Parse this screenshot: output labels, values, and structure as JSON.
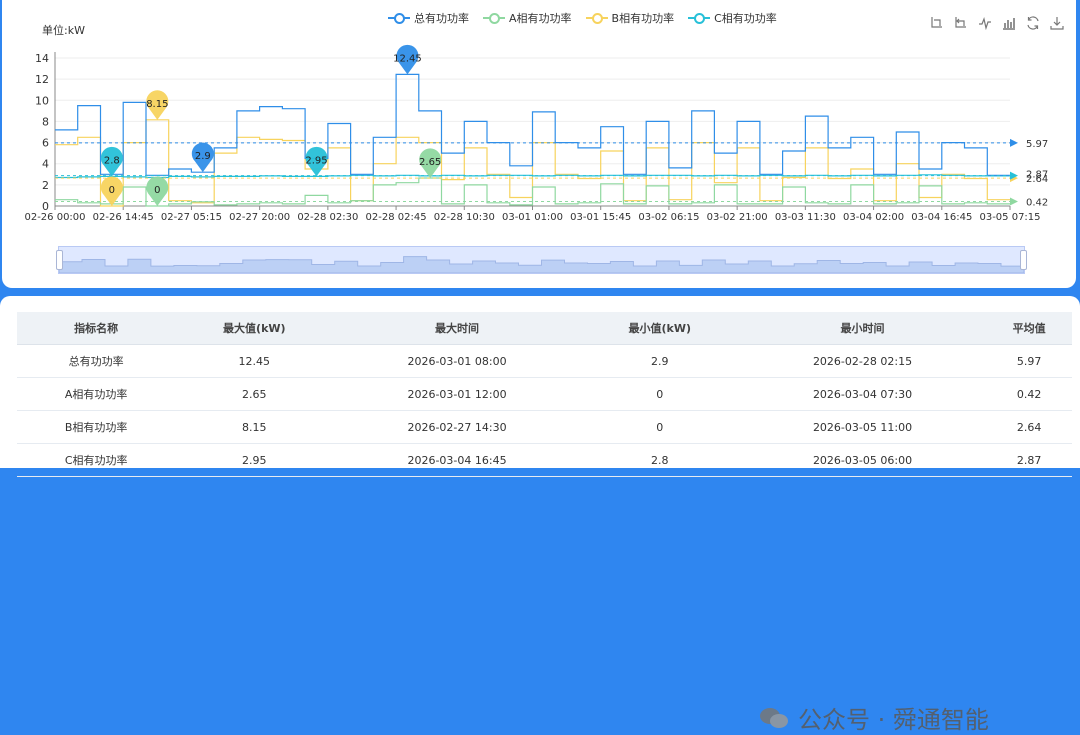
{
  "chart": {
    "unit_label": "单位:kW",
    "legend": [
      {
        "name": "总有功功率",
        "color": "#2f8ee8"
      },
      {
        "name": "A相有功功率",
        "color": "#8fd8a0"
      },
      {
        "name": "B相有功功率",
        "color": "#f7d35d"
      },
      {
        "name": "C相有功功率",
        "color": "#27c0d8"
      }
    ],
    "toolbox_icons": [
      "zoom-icon",
      "zoom-reset-icon",
      "line-chart-icon",
      "bar-chart-icon",
      "refresh-icon",
      "download-icon"
    ]
  },
  "chart_data": {
    "type": "line",
    "ylabel": "单位:kW",
    "ylim": [
      0,
      14
    ],
    "y_ticks": [
      0,
      2,
      4,
      6,
      8,
      10,
      12,
      14
    ],
    "categories": [
      "02-26 00:00",
      "02-26 14:45",
      "02-27 05:15",
      "02-27 20:00",
      "02-28 02:30",
      "02-28 02:45",
      "02-28 10:30",
      "03-01 01:00",
      "03-01 15:45",
      "03-02 06:15",
      "03-02 21:00",
      "03-03 11:30",
      "03-04 02:00",
      "03-04 16:45",
      "03-05 07:15"
    ],
    "series": [
      {
        "name": "总有功功率",
        "color": "#2f8ee8",
        "values": [
          7.2,
          9.5,
          3.0,
          9.8,
          2.9,
          3.5,
          3.2,
          5.5,
          9.0,
          9.4,
          9.2,
          4.5,
          7.8,
          3.0,
          6.5,
          12.45,
          9.0,
          5.0,
          8.0,
          6.0,
          3.8,
          8.9,
          6.0,
          5.5,
          7.5,
          3.0,
          8.0,
          3.6,
          9.0,
          5.0,
          8.0,
          3.0,
          5.2,
          8.5,
          5.5,
          6.5,
          3.0,
          7.0,
          3.5,
          6.0,
          5.5,
          2.9
        ],
        "markers": [
          {
            "label": "12.45",
            "kind": "max",
            "x_index": 15
          },
          {
            "label": "2.9",
            "kind": "min",
            "x_index": 6
          }
        ],
        "average": 5.97
      },
      {
        "name": "A相有功功率",
        "color": "#8fd8a0",
        "values": [
          0.6,
          0.3,
          0.2,
          1.8,
          0,
          0.2,
          0.4,
          0.1,
          0.2,
          0.3,
          0.2,
          1.0,
          0.3,
          0.5,
          2.0,
          2.2,
          2.65,
          0.2,
          2.0,
          0.3,
          0.1,
          1.8,
          0.2,
          0.3,
          2.1,
          0.2,
          1.9,
          0.2,
          0.3,
          2.0,
          0.2,
          0.2,
          1.8,
          0.3,
          0.2,
          2.0,
          0.2,
          0.3,
          1.9,
          0.2,
          0.3,
          0.2
        ],
        "markers": [
          {
            "label": "2.65",
            "kind": "max",
            "x_index": 16
          },
          {
            "label": "0",
            "kind": "min",
            "x_index": 4
          }
        ],
        "average": 0.42
      },
      {
        "name": "B相有功功率",
        "color": "#f7d35d",
        "values": [
          5.8,
          6.5,
          0,
          6.0,
          8.15,
          0.5,
          0.3,
          5.0,
          6.5,
          6.3,
          6.2,
          3.5,
          5.5,
          0.5,
          4.0,
          6.5,
          6.0,
          2.5,
          5.5,
          3.0,
          0.8,
          6.0,
          3.0,
          2.6,
          5.2,
          0.5,
          5.5,
          0.6,
          6.0,
          2.2,
          5.5,
          0.5,
          2.7,
          5.5,
          2.6,
          3.5,
          0.5,
          4.0,
          0.8,
          3.0,
          2.6,
          0.6
        ],
        "markers": [
          {
            "label": "8.15",
            "kind": "max",
            "x_index": 4
          },
          {
            "label": "0",
            "kind": "min",
            "x_index": 2
          }
        ],
        "average": 2.64
      },
      {
        "name": "C相有功功率",
        "color": "#27c0d8",
        "values": [
          2.7,
          2.75,
          2.8,
          2.75,
          2.7,
          2.8,
          2.75,
          2.8,
          2.8,
          2.85,
          2.8,
          2.8,
          2.85,
          2.9,
          2.85,
          2.9,
          2.85,
          2.9,
          2.85,
          2.9,
          2.9,
          2.85,
          2.9,
          2.85,
          2.9,
          2.85,
          2.9,
          2.9,
          2.85,
          2.9,
          2.85,
          2.9,
          2.85,
          2.9,
          2.85,
          2.9,
          2.85,
          2.9,
          2.95,
          2.9,
          2.85,
          2.85
        ],
        "markers": [
          {
            "label": "2.8",
            "kind": "min",
            "x_index": 2
          },
          {
            "label": "2.95",
            "kind": "max",
            "x_index": 11
          }
        ],
        "average": 2.87
      }
    ],
    "grid": true,
    "legend_position": "top-center"
  },
  "table": {
    "headers": [
      "指标名称",
      "最大值(kW)",
      "最大时间",
      "最小值(kW)",
      "最小时间",
      "平均值"
    ],
    "rows": [
      [
        "总有功功率",
        "12.45",
        "2026-03-01 08:00",
        "2.9",
        "2026-02-28 02:15",
        "5.97"
      ],
      [
        "A相有功功率",
        "2.65",
        "2026-03-01 12:00",
        "0",
        "2026-03-04 07:30",
        "0.42"
      ],
      [
        "B相有功功率",
        "8.15",
        "2026-02-27 14:30",
        "0",
        "2026-03-05 11:00",
        "2.64"
      ],
      [
        "C相有功功率",
        "2.95",
        "2026-03-04 16:45",
        "2.8",
        "2026-03-05 06:00",
        "2.87"
      ]
    ]
  },
  "watermark": {
    "text": "公众号 · 舜通智能"
  }
}
